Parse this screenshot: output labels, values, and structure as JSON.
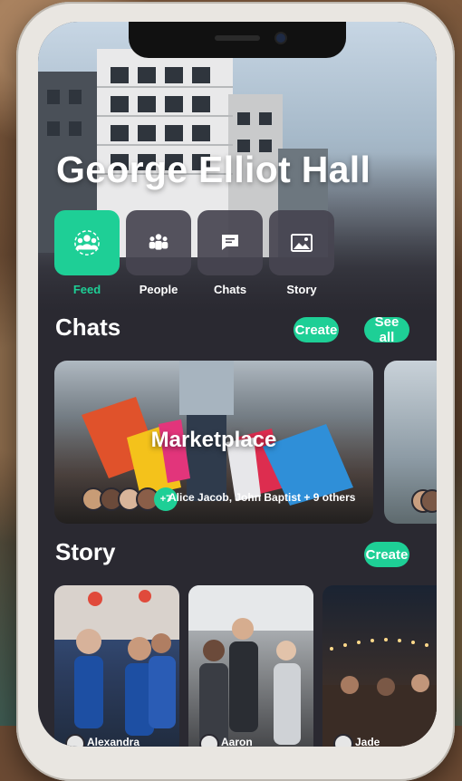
{
  "hall": {
    "title": "George Elliot Hall"
  },
  "tabs": [
    {
      "label": "Feed",
      "icon": "people-group-icon",
      "active": true
    },
    {
      "label": "People",
      "icon": "people-icon",
      "active": false
    },
    {
      "label": "Chats",
      "icon": "chat-bubble-icon",
      "active": false
    },
    {
      "label": "Story",
      "icon": "image-icon",
      "active": false
    }
  ],
  "chats_section": {
    "title": "Chats",
    "create_label": "Create",
    "see_all_label": "See all",
    "cards": [
      {
        "title": "Marketplace",
        "more_count": "+7",
        "members": "Alice Jacob, John Baptist",
        "others": "+ 9 others"
      }
    ]
  },
  "story_section": {
    "title": "Story",
    "create_label": "Create",
    "stories": [
      {
        "name": "Alexandra"
      },
      {
        "name": "Aaron"
      },
      {
        "name": "Jade"
      }
    ]
  },
  "colors": {
    "accent": "#1ecf96",
    "surface": "#2a2931",
    "tile": "#46444f"
  }
}
